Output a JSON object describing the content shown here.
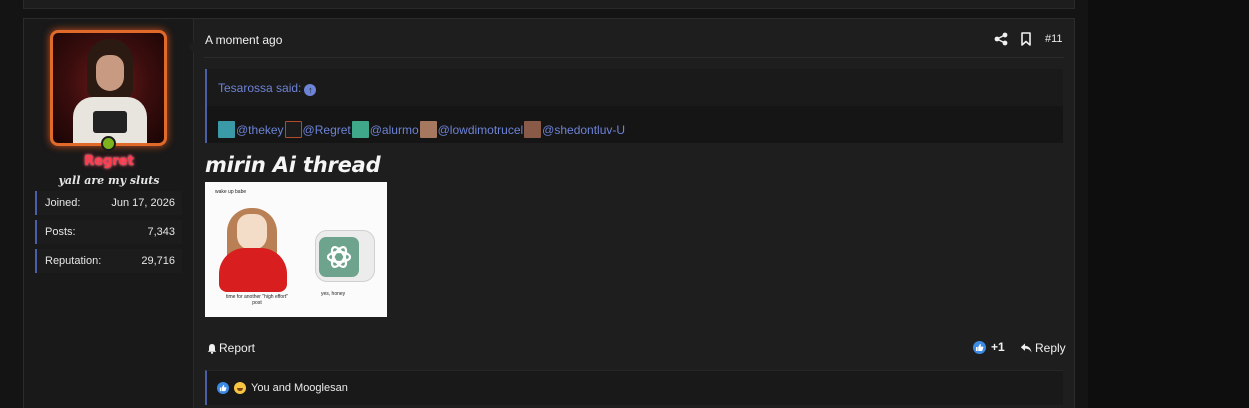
{
  "post": {
    "time": "A moment ago",
    "number": "#11",
    "user": {
      "name": "Regret",
      "title": "yall are my sluts",
      "stats": [
        {
          "label": "Joined:",
          "value": "Jun 17, 2026"
        },
        {
          "label": "Posts:",
          "value": "7,343"
        },
        {
          "label": "Reputation:",
          "value": "29,716"
        }
      ]
    },
    "quote": {
      "author": "Tesarossa said:",
      "mentions": [
        "@thekey",
        "@Regret",
        "@alurmo",
        "@lowdimotrucel",
        "@shedontluv-U"
      ],
      "mention_avatar_colors": [
        "#3a9aa8",
        "#b34a2a",
        "#3fa88a",
        "#a67860",
        "#8a5a48"
      ]
    },
    "body_text": "mirin Ai thread",
    "meme": {
      "top_text": "wake up babe",
      "left_caption": "time for another \"high effort\" post",
      "right_caption": "yes, honey"
    },
    "actions": {
      "report": "Report",
      "like_count": "+1",
      "reply": "Reply"
    },
    "reactions_text": "You and Mooglesan",
    "colors": {
      "accent": "#6d83d6",
      "username_glow": "#ff3b4e",
      "online": "#7db31e",
      "like": "#3b8be4"
    }
  }
}
